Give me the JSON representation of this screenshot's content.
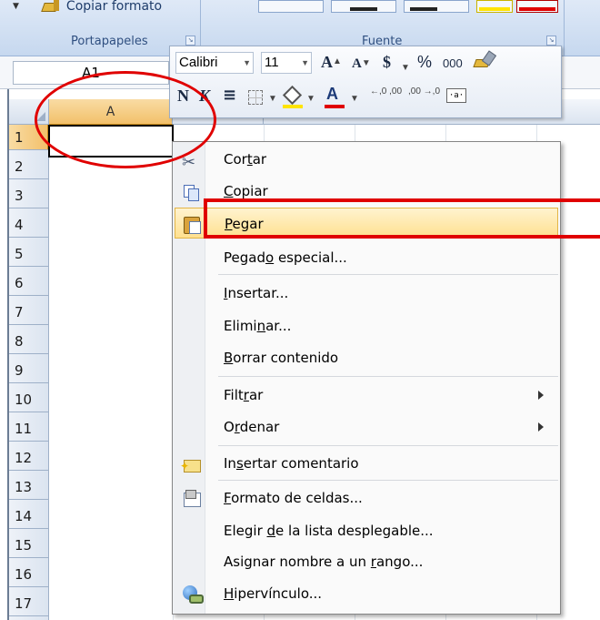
{
  "ribbon": {
    "copy_format_label": "Copiar formato",
    "group_clipboard": "Portapapeles",
    "group_font": "Fuente",
    "font_swatch_colors": [
      "#f5f8fc",
      "#f5f8fc",
      "#ffe400",
      "#e00000"
    ]
  },
  "namebox": {
    "value": "A1"
  },
  "grid": {
    "column_headers": [
      "A"
    ],
    "row_headers": [
      "1",
      "2",
      "3",
      "4",
      "5",
      "6",
      "7",
      "8",
      "9",
      "10",
      "11",
      "12",
      "13",
      "14",
      "15",
      "16",
      "17"
    ],
    "selected_cell": "A1"
  },
  "mini_toolbar": {
    "font_name": "Calibri",
    "font_size": "11",
    "grow_font": "A",
    "shrink_font": "A",
    "currency": "$",
    "percent": "%",
    "thousands": "000",
    "bold": "N",
    "italic": "K",
    "align": "≡",
    "font_color_glyph": "A",
    "dec_increase": "←,0 ,00",
    "dec_decrease": ",00 →,0",
    "highlight_color": "#ffe400",
    "font_color": "#e00000"
  },
  "context_menu": {
    "items": [
      {
        "pre": "Cor",
        "u": "t",
        "post": "ar",
        "icon": "scissors-icon"
      },
      {
        "pre": "",
        "u": "C",
        "post": "opiar",
        "icon": "copy-icon"
      },
      {
        "pre": "",
        "u": "P",
        "post": "egar",
        "icon": "paste-icon",
        "highlighted": true
      },
      {
        "pre": "Pegad",
        "u": "o",
        "post": " especial...",
        "icon": ""
      },
      {
        "pre": "",
        "u": "I",
        "post": "nsertar...",
        "icon": ""
      },
      {
        "pre": "Elimi",
        "u": "n",
        "post": "ar...",
        "icon": ""
      },
      {
        "pre": "",
        "u": "B",
        "post": "orrar contenido",
        "icon": ""
      },
      {
        "pre": "Filt",
        "u": "r",
        "post": "ar",
        "icon": "",
        "submenu": true
      },
      {
        "pre": "O",
        "u": "r",
        "post": "denar",
        "icon": "",
        "submenu": true
      },
      {
        "pre": "In",
        "u": "s",
        "post": "ertar comentario",
        "icon": "insert-comment-icon"
      },
      {
        "pre": "",
        "u": "F",
        "post": "ormato de celdas...",
        "icon": "format-cells-icon"
      },
      {
        "pre": "Elegir ",
        "u": "d",
        "post": "e la lista desplegable...",
        "icon": ""
      },
      {
        "pre": "Asignar nombre a un ",
        "u": "r",
        "post": "ango...",
        "icon": ""
      },
      {
        "pre": "",
        "u": "H",
        "post": "ipervínculo...",
        "icon": "hyperlink-icon"
      }
    ]
  },
  "annotations": {
    "color": "#e00000"
  }
}
